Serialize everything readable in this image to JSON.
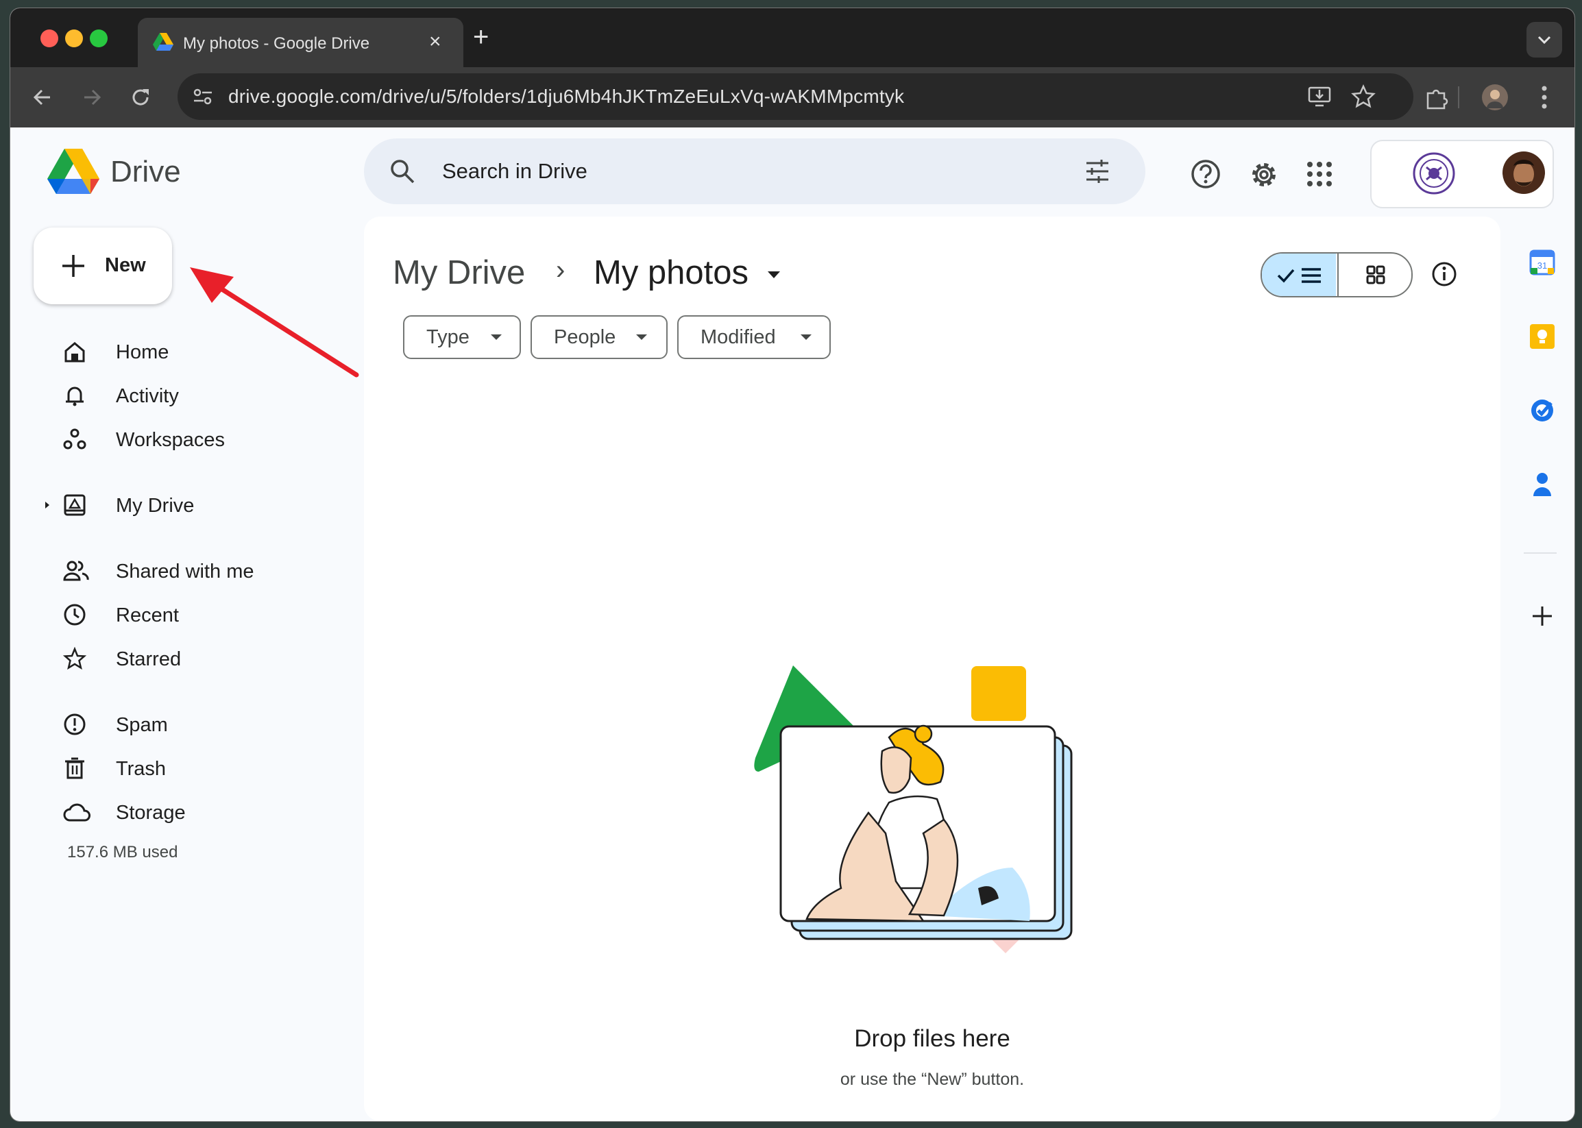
{
  "browser": {
    "tab_title": "My photos - Google Drive",
    "new_tab": "+",
    "tab_close": "×",
    "url": "drive.google.com/drive/u/5/folders/1dju6Mb4hJKTmZeEuLxVq-wAKMMpcmtyk"
  },
  "app": {
    "name": "Drive",
    "search_placeholder": "Search in Drive",
    "new_button": "New"
  },
  "sidebar": {
    "items": [
      {
        "label": "Home",
        "icon": "home-icon"
      },
      {
        "label": "Activity",
        "icon": "bell-icon"
      },
      {
        "label": "Workspaces",
        "icon": "workspaces-icon"
      },
      {
        "label": "My Drive",
        "icon": "my-drive-icon"
      },
      {
        "label": "Shared with me",
        "icon": "people-icon"
      },
      {
        "label": "Recent",
        "icon": "clock-icon"
      },
      {
        "label": "Starred",
        "icon": "star-icon"
      },
      {
        "label": "Spam",
        "icon": "spam-icon"
      },
      {
        "label": "Trash",
        "icon": "trash-icon"
      },
      {
        "label": "Storage",
        "icon": "cloud-icon"
      }
    ],
    "storage_used": "157.6 MB used"
  },
  "main": {
    "breadcrumb_root": "My Drive",
    "breadcrumb_sep": "›",
    "breadcrumb_current": "My photos",
    "filters": [
      "Type",
      "People",
      "Modified"
    ],
    "empty_title": "Drop files here",
    "empty_subtitle": "or use the “New” button."
  },
  "colors": {
    "accent": "#c2e7ff",
    "drive_green": "#1ea446",
    "drive_yellow": "#fbbc04",
    "drive_blue": "#4285f4",
    "annotation_red": "#e8202a"
  }
}
